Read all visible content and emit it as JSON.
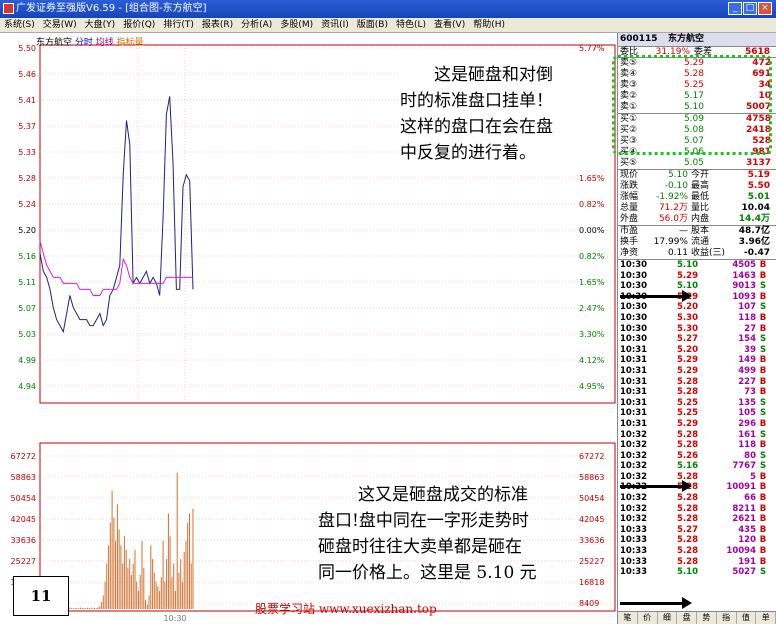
{
  "window": {
    "title": "广发证券至强版V6.59 - [组合图-东方航空]",
    "min": "_",
    "max": "□",
    "close": "×"
  },
  "menu": [
    "系统(S)",
    "交易(W)",
    "大盘(Y)",
    "报价(Q)",
    "排行(T)",
    "报表(R)",
    "分析(A)",
    "多股(M)",
    "资讯(I)",
    "版面(B)",
    "特色(L)",
    "查看(V)",
    "帮助(H)"
  ],
  "chart_tabs": {
    "name": "东方航空",
    "tab1": "分时",
    "tab2": "均线",
    "tab3": "指标量"
  },
  "chart_data": [
    {
      "type": "line",
      "y_left_ticks": [
        "5.50",
        "5.46",
        "5.41",
        "5.37",
        "5.33",
        "5.28",
        "5.24",
        "5.20",
        "5.16",
        "5.11",
        "5.07",
        "5.03",
        "4.99",
        "4.94"
      ],
      "y_right_ticks": [
        "5.77%",
        "4.95%",
        "4.12%",
        "3.30%",
        "2.47%",
        "1.65%",
        "0.82%",
        "0.00%",
        "0.82%",
        "1.65%",
        "2.47%",
        "3.30%",
        "4.12%",
        "4.95%"
      ],
      "series": [
        {
          "values": [
            5.16,
            5.13,
            5.12,
            5.1,
            5.07,
            5.05,
            5.04,
            5.03,
            5.06,
            5.09,
            5.07,
            5.06,
            5.05,
            5.05,
            5.05,
            5.04,
            5.04,
            5.05,
            5.06,
            5.04,
            5.05,
            5.09,
            5.1,
            5.12,
            5.14,
            5.29,
            5.38,
            5.34,
            5.11,
            5.12,
            5.11,
            5.12,
            5.13,
            5.11,
            5.12,
            5.11,
            5.09,
            5.22,
            5.39,
            5.42,
            5.31,
            5.1,
            5.1,
            5.27,
            5.29,
            5.28,
            5.1
          ]
        },
        {
          "values": [
            5.18,
            5.16,
            5.14,
            5.13,
            5.12,
            5.12,
            5.12,
            5.11,
            5.11,
            5.11,
            5.11,
            5.11,
            5.1,
            5.1,
            5.1,
            5.1,
            5.09,
            5.09,
            5.09,
            5.1,
            5.1,
            5.1,
            5.1,
            5.1,
            5.11,
            5.15,
            5.14,
            5.12,
            5.11,
            5.11,
            5.11,
            5.11,
            5.11,
            5.11,
            5.11,
            5.11,
            5.11,
            5.11,
            5.12,
            5.12,
            5.12,
            5.12,
            5.12,
            5.12,
            5.12,
            5.12,
            5.12
          ]
        }
      ]
    },
    {
      "type": "bar",
      "y_left_ticks": [
        "67272",
        "58863",
        "50454",
        "42045",
        "33636",
        "25227",
        "16818",
        "8409"
      ],
      "y_right_ticks": [
        "67272",
        "58863",
        "50454",
        "42045",
        "33636",
        "25227",
        "16818",
        "8409"
      ],
      "x_ticks": [
        "10:30"
      ],
      "values": [
        500,
        300,
        400,
        600,
        300,
        500,
        400,
        300,
        500,
        400,
        600,
        300,
        400,
        500,
        400,
        300,
        500,
        600,
        400,
        300,
        500,
        400,
        300,
        600,
        500,
        400,
        300,
        500,
        400,
        600,
        300,
        500,
        400,
        800,
        1200,
        3000,
        6000,
        12000,
        20000,
        28000,
        38000,
        52000,
        40000,
        30000,
        46000,
        35000,
        28000,
        20000,
        32000,
        26000,
        18000,
        22000,
        15000,
        20000,
        26000,
        12000,
        8000,
        15000,
        30000,
        18000,
        4000,
        2000,
        6000,
        28000,
        22000,
        16000,
        12000,
        10000,
        8000,
        14000,
        30000,
        12000,
        22000,
        42000,
        32000,
        14000,
        20000,
        8000,
        60000,
        16000,
        22000,
        12000,
        25000,
        30000,
        38000,
        42000,
        20000,
        44000
      ]
    }
  ],
  "quote": {
    "code": "600115",
    "name": "东方航空",
    "weibi_label": "委比",
    "weibi": "31.19%",
    "weicha_label": "委差",
    "weicha": "5618",
    "asks": [
      {
        "label": "卖⑤",
        "price": "5.29",
        "vol": "472"
      },
      {
        "label": "卖④",
        "price": "5.28",
        "vol": "691"
      },
      {
        "label": "卖③",
        "price": "5.25",
        "vol": "34"
      },
      {
        "label": "卖②",
        "price": "5.17",
        "vol": "10"
      },
      {
        "label": "卖①",
        "price": "5.10",
        "vol": "5007"
      }
    ],
    "bids": [
      {
        "label": "买①",
        "price": "5.09",
        "vol": "4758"
      },
      {
        "label": "买②",
        "price": "5.08",
        "vol": "2418"
      },
      {
        "label": "买③",
        "price": "5.07",
        "vol": "528"
      },
      {
        "label": "买④",
        "price": "5.06",
        "vol": "981"
      },
      {
        "label": "买⑤",
        "price": "5.05",
        "vol": "3137"
      }
    ],
    "stats": [
      {
        "a": "现价",
        "b": "5.10",
        "bc": "green",
        "c": "今开",
        "d": "5.19",
        "dc": "red"
      },
      {
        "a": "涨跌",
        "b": "-0.10",
        "bc": "green",
        "c": "最高",
        "d": "5.50",
        "dc": "red"
      },
      {
        "a": "涨幅",
        "b": "-1.92%",
        "bc": "green",
        "c": "最低",
        "d": "5.01",
        "dc": "green"
      },
      {
        "a": "总量",
        "b": "71.2万",
        "bc": "red",
        "c": "量比",
        "d": "10.04",
        "dc": "black"
      },
      {
        "a": "外盘",
        "b": "56.0万",
        "bc": "red",
        "c": "内盘",
        "d": "14.4万",
        "dc": "green"
      }
    ],
    "stats2": [
      {
        "a": "市盈",
        "b": "—",
        "c": "股本",
        "d": "48.7亿"
      },
      {
        "a": "换手",
        "b": "17.99%",
        "c": "流通",
        "d": "3.96亿"
      },
      {
        "a": "净资",
        "b": "0.11",
        "c": "收益(三)",
        "d": "-0.47"
      }
    ],
    "ticks": [
      [
        "10:30",
        "5.10",
        "4505",
        "B"
      ],
      [
        "10:30",
        "5.29",
        "1463",
        "B"
      ],
      [
        "10:30",
        "5.10",
        "9013",
        "S"
      ],
      [
        "10:30",
        "5.29",
        "1093",
        "B"
      ],
      [
        "10:30",
        "5.20",
        "107",
        "S"
      ],
      [
        "10:30",
        "5.30",
        "118",
        "B"
      ],
      [
        "10:30",
        "5.30",
        "27",
        "B"
      ],
      [
        "10:30",
        "5.27",
        "154",
        "S"
      ],
      [
        "10:31",
        "5.20",
        "39",
        "S"
      ],
      [
        "10:31",
        "5.29",
        "149",
        "B"
      ],
      [
        "10:31",
        "5.29",
        "499",
        "B"
      ],
      [
        "10:31",
        "5.28",
        "227",
        "B"
      ],
      [
        "10:31",
        "5.28",
        "73",
        "B"
      ],
      [
        "10:31",
        "5.25",
        "135",
        "S"
      ],
      [
        "10:31",
        "5.25",
        "105",
        "S"
      ],
      [
        "10:31",
        "5.29",
        "296",
        "B"
      ],
      [
        "10:32",
        "5.28",
        "161",
        "S"
      ],
      [
        "10:32",
        "5.28",
        "118",
        "B"
      ],
      [
        "10:32",
        "5.26",
        "80",
        "S"
      ],
      [
        "10:32",
        "5.16",
        "7767",
        "S"
      ],
      [
        "10:32",
        "5.28",
        "5",
        "B"
      ],
      [
        "10:32",
        "5.28",
        "10091",
        "B"
      ],
      [
        "10:32",
        "5.28",
        "66",
        "B"
      ],
      [
        "10:32",
        "5.28",
        "8211",
        "B"
      ],
      [
        "10:32",
        "5.28",
        "2621",
        "B"
      ],
      [
        "10:33",
        "5.27",
        "435",
        "B"
      ],
      [
        "10:33",
        "5.28",
        "120",
        "B"
      ],
      [
        "10:33",
        "5.28",
        "10094",
        "B"
      ],
      [
        "10:33",
        "5.28",
        "191",
        "B"
      ],
      [
        "10:33",
        "5.10",
        "5027",
        "S"
      ]
    ],
    "bottom_tabs": [
      "笔",
      "价",
      "细",
      "盘",
      "势",
      "指",
      "值",
      "单"
    ]
  },
  "annotations": {
    "top": [
      "这是砸盘和对倒",
      "时的标准盘口挂单！",
      "这样的盘口在会在盘",
      "中反复的进行着。"
    ],
    "bottom": [
      "这又是砸盘成交的标准",
      "盘口!盘中同在一字形走势时",
      "砸盘时往往大卖单都是砸在",
      "同一价格上。这里是 5.10 元"
    ],
    "page_number": "11",
    "footer": "股票学习站   www.xuexizhan.top"
  }
}
